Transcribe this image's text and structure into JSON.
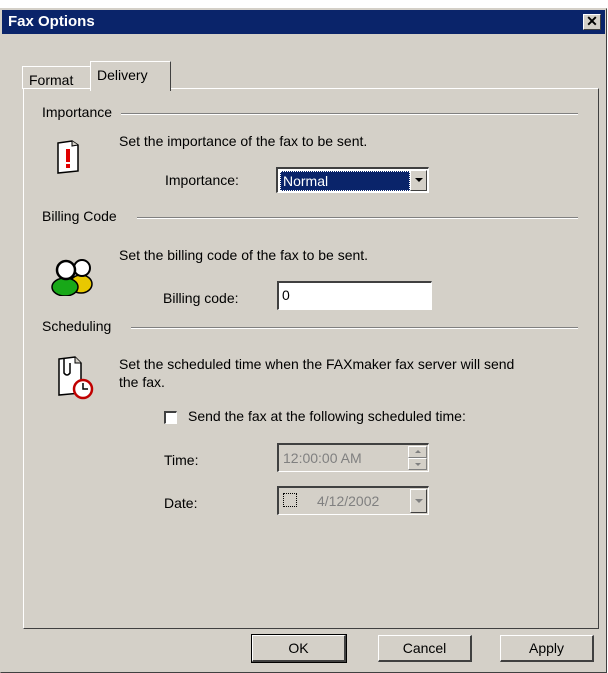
{
  "window": {
    "title": "Fax Options",
    "close_symbol": "✕"
  },
  "tabs": [
    {
      "label": "Format",
      "active": false
    },
    {
      "label": "Delivery",
      "active": true
    }
  ],
  "importance": {
    "section_label": "Importance",
    "description": "Set the importance of the fax to be sent.",
    "field_label": "Importance:",
    "selected_value": "Normal",
    "icon": "exclamation-document-icon"
  },
  "billing": {
    "section_label": "Billing Code",
    "description": "Set the billing code of the fax to be sent.",
    "field_label": "Billing code:",
    "value": "0",
    "icon": "users-icon"
  },
  "scheduling": {
    "section_label": "Scheduling",
    "description_line1": "Set the scheduled time when the FAXmaker fax server will send",
    "description_line2": "the fax.",
    "checkbox_label": "Send the fax at the following scheduled time:",
    "checkbox_checked": false,
    "time_label": "Time:",
    "time_value": "12:00:00 AM",
    "date_label": "Date:",
    "date_value": "4/12/2002",
    "icon": "document-clock-icon"
  },
  "buttons": {
    "ok": "OK",
    "cancel": "Cancel",
    "apply": "Apply"
  },
  "colors": {
    "title_bar": "#0a246a",
    "face": "#d4d0c8",
    "selection": "#0a246a"
  }
}
